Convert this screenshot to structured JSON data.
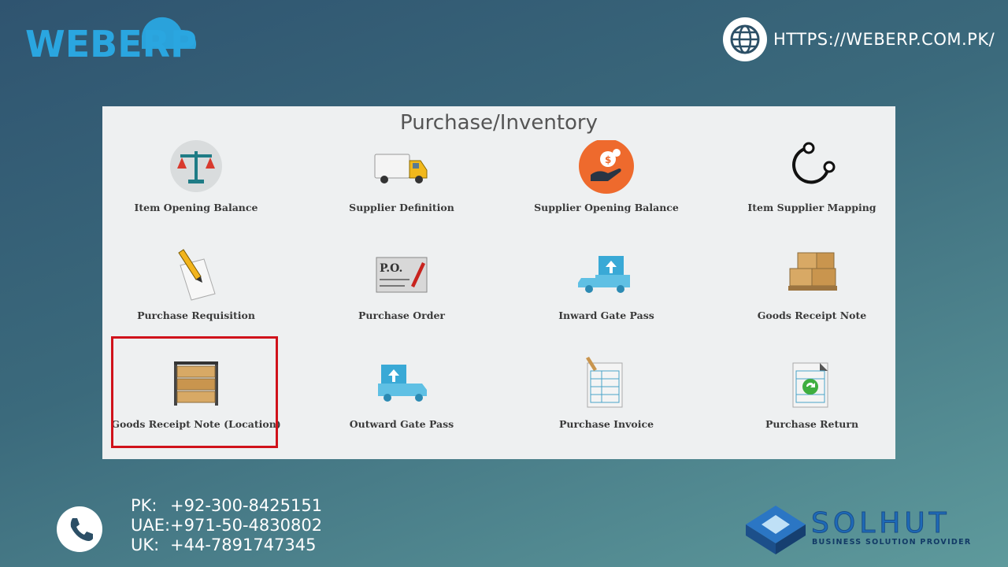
{
  "header": {
    "logo_text": "WEBERP",
    "url": "HTTPS://WEBERP.COM.PK/"
  },
  "panel": {
    "title": "Purchase/Inventory",
    "tiles": [
      {
        "label": "Item Opening Balance",
        "icon": "scales-icon"
      },
      {
        "label": "Supplier Definition",
        "icon": "truck-icon"
      },
      {
        "label": "Supplier Opening Balance",
        "icon": "money-hand-icon"
      },
      {
        "label": "Item Supplier Mapping",
        "icon": "mapping-icon"
      },
      {
        "label": "Purchase Requisition",
        "icon": "pencil-paper-icon"
      },
      {
        "label": "Purchase Order",
        "icon": "po-document-icon"
      },
      {
        "label": "Inward Gate Pass",
        "icon": "inward-truck-icon"
      },
      {
        "label": "Goods Receipt Note",
        "icon": "boxes-pallet-icon"
      },
      {
        "label": "Goods Receipt Note (Location)",
        "icon": "shelf-boxes-icon"
      },
      {
        "label": "Outward Gate Pass",
        "icon": "outward-truck-icon"
      },
      {
        "label": "Purchase Invoice",
        "icon": "invoice-icon"
      },
      {
        "label": "Purchase Return",
        "icon": "return-sheet-icon"
      }
    ]
  },
  "footer": {
    "contacts": [
      {
        "country": "PK:",
        "number": "+92-300-8425151"
      },
      {
        "country": "UAE:",
        "number": "+971-50-4830802"
      },
      {
        "country": "UK:",
        "number": "+44-7891747345"
      }
    ],
    "company": "SOLHUT",
    "tagline": "BUSINESS SOLUTION PROVIDER"
  },
  "colors": {
    "highlight": "#d0121b",
    "logo_blue": "#2aa6e0",
    "brand_blue": "#1e6ab8"
  }
}
